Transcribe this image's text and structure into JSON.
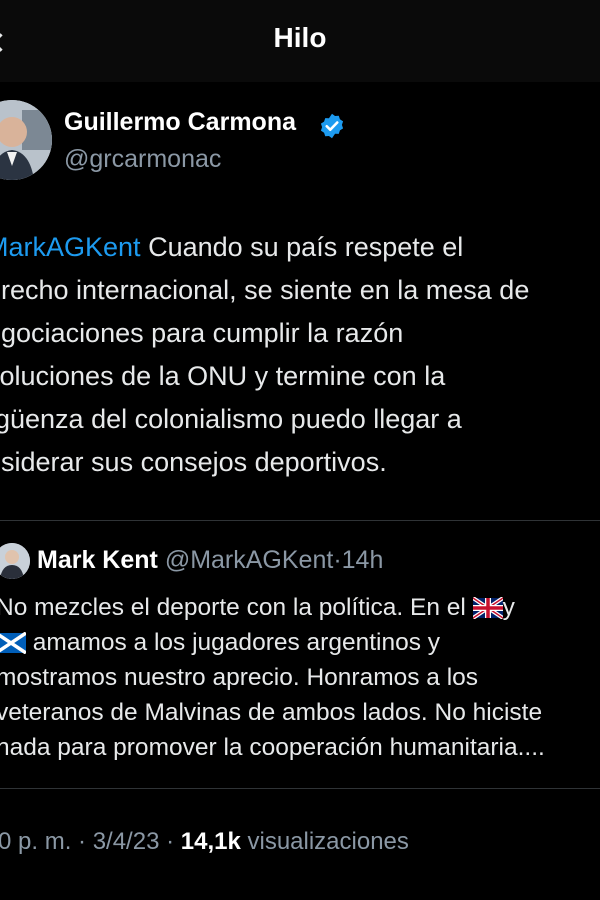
{
  "header": {
    "title": "Hilo",
    "back_icon": "back-arrow-icon"
  },
  "tweet": {
    "author_name": "Guillermo Carmona",
    "author_handle": "@grcarmonac",
    "verified_icon": "verified-badge-icon",
    "mention": "MarkAGKent",
    "lines": [
      " Cuando su país respete el",
      "erecho internacional, se siente en la mesa de",
      "egociaciones para cumplir la razón",
      "soluciones de la ONU y termine con la",
      "rgüenza del colonialismo puedo llegar a",
      "nsiderar sus consejos deportivos."
    ]
  },
  "quoted": {
    "name": "Mark Kent",
    "handle": "@MarkAGKent",
    "time": "14h",
    "line1_a": "No mezcles el deporte con la política.  En el ",
    "line1_b": "y",
    "line2": " amamos a los jugadores argentinos y",
    "line3": "mostramos nuestro aprecio. Honramos a los",
    "line4": "veteranos de Malvinas de ambos lados. No hiciste",
    "line5": "nada para promover la cooperación humanitaria....",
    "flag_uk_icon": "uk-flag-icon",
    "flag_scotland_icon": "scotland-flag-icon"
  },
  "meta": {
    "time": "0 p. m.",
    "date": "3/4/23",
    "views_count": "14,1k",
    "views_label": "visualizaciones"
  },
  "colors": {
    "background": "#000000",
    "text": "#e7e9ea",
    "muted": "#8b98a5",
    "accent": "#1d9bf0"
  }
}
